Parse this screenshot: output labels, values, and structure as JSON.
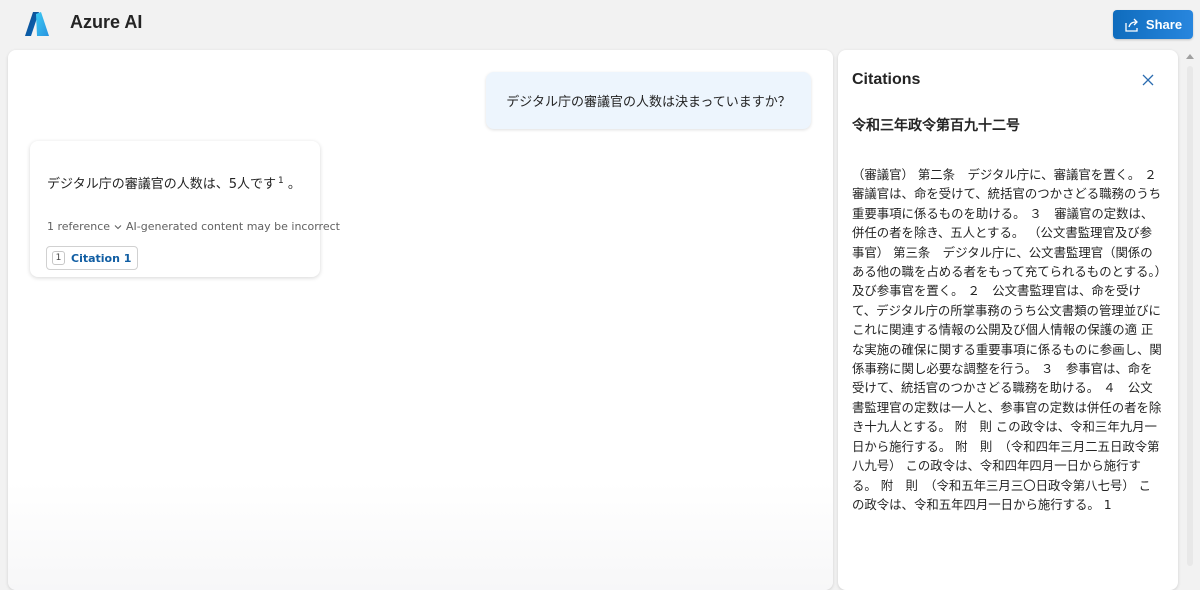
{
  "app": {
    "title": "Azure AI",
    "logo_icon": "azure-logo-icon"
  },
  "toolbar": {
    "share_label": "Share",
    "share_icon": "share-icon",
    "accent": "#0f6cbd"
  },
  "chat": {
    "user_message": "デジタル庁の審議官の人数は決まっていますか？",
    "answer": {
      "text": "デジタル庁の審議官の人数は、5人です",
      "citation_marker": "1",
      "trailing": "。",
      "reference_count": "1 reference",
      "disclaimer": "AI-generated content may be incorrect",
      "citations": [
        {
          "number": "1",
          "label": "Citation 1"
        }
      ]
    }
  },
  "citations_panel": {
    "title": "Citations",
    "doc_title": "令和三年政令第百九十二号",
    "doc_body": "（審議官） 第二条　デジタル庁に、審議官を置く。 ２　審議官は、命を受けて、統括官のつかさどる職務のうち重要事項に係るものを助ける。 ３　審議官の定数は、併任の者を除き、五人とする。 （公文書監理官及び参事官） 第三条　デジタル庁に、公文書監理官（関係のある他の職を占める者をもって充てられるものとする。）及び参事官を置く。 ２　公文書監理官は、命を受けて、デジタル庁の所掌事務のうち公文書類の管理並びにこれに関連する情報の公開及び個人情報の保護の適 正な実施の確保に関する重要事項に係るものに参画し、関係事務に関し必要な調整を行う。 ３　参事官は、命を受けて、統括官のつかさどる職務を助ける。 ４　公文書監理官の定数は一人と、参事官の定数は併任の者を除き十九人とする。 附　則 この政令は、令和三年九月一日から施行する。 附　則　（令和四年三月二五日政令第八九号） この政令は、令和四年四月一日から施行する。 附　則　（令和五年三月三〇日政令第八七号） この政令は、令和五年四月一日から施行する。 1"
  }
}
